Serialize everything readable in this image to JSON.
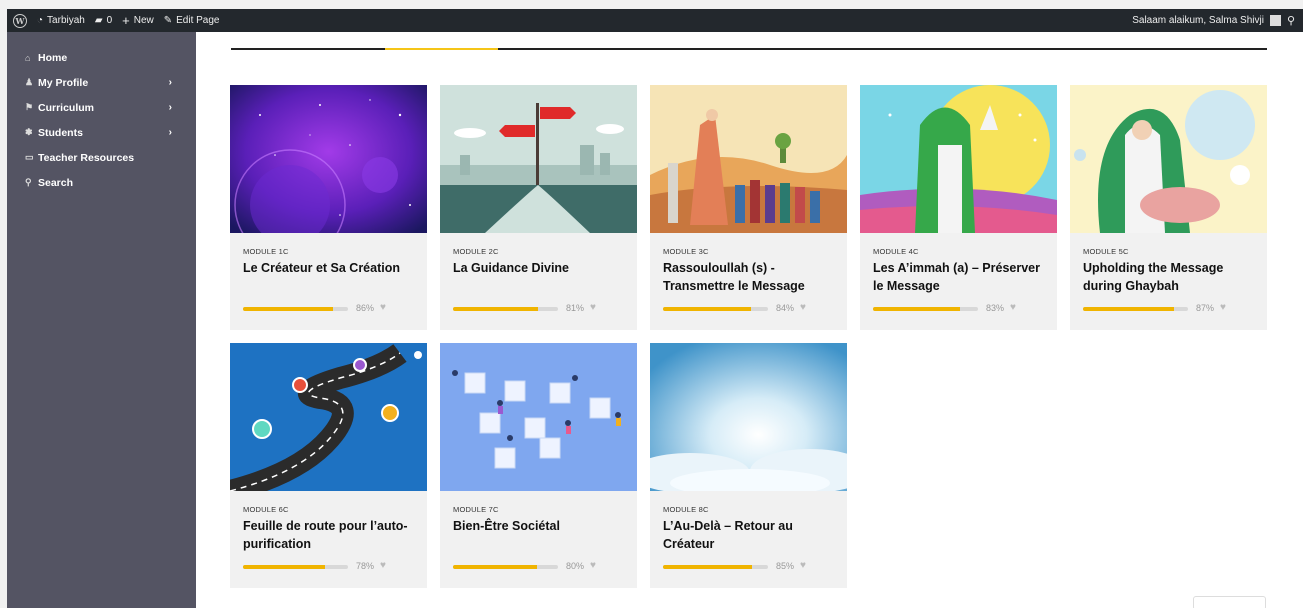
{
  "adminbar": {
    "site_name": "Tarbiyah",
    "comments_count": "0",
    "new_label": "New",
    "edit_label": "Edit Page",
    "greeting": "Salaam alaikum, Salma Shivji"
  },
  "sidebar": {
    "items": [
      {
        "label": "Home",
        "icon": "home-icon"
      },
      {
        "label": "My Profile",
        "icon": "person-icon"
      },
      {
        "label": "Curriculum",
        "icon": "flag-icon"
      },
      {
        "label": "Students",
        "icon": "group-icon"
      },
      {
        "label": "Teacher Resources",
        "icon": "book-icon"
      },
      {
        "label": "Search",
        "icon": "search-icon"
      }
    ]
  },
  "modules": [
    {
      "module": "MODULE 1C",
      "title": "Le Créateur et Sa Création",
      "progress": 86,
      "pct": "86%"
    },
    {
      "module": "MODULE 2C",
      "title": "La Guidance Divine",
      "progress": 81,
      "pct": "81%"
    },
    {
      "module": "MODULE 3C",
      "title": "Rassouloullah (s) - Transmettre le Message",
      "progress": 84,
      "pct": "84%"
    },
    {
      "module": "MODULE 4C",
      "title": "Les A’immah (a) – Préserver le Message",
      "progress": 83,
      "pct": "83%"
    },
    {
      "module": "MODULE 5C",
      "title": "Upholding the Message during Ghaybah",
      "progress": 87,
      "pct": "87%"
    },
    {
      "module": "MODULE 6C",
      "title": "Feuille de route pour l’auto-purification",
      "progress": 78,
      "pct": "78%"
    },
    {
      "module": "MODULE 7C",
      "title": "Bien-Être Sociétal",
      "progress": 80,
      "pct": "80%"
    },
    {
      "module": "MODULE 8C",
      "title": "L’Au-Delà – Retour au Créateur",
      "progress": 85,
      "pct": "85%"
    }
  ],
  "colors": {
    "accent": "#f0b400",
    "sidebar": "#545463",
    "adminbar": "#23282d"
  }
}
